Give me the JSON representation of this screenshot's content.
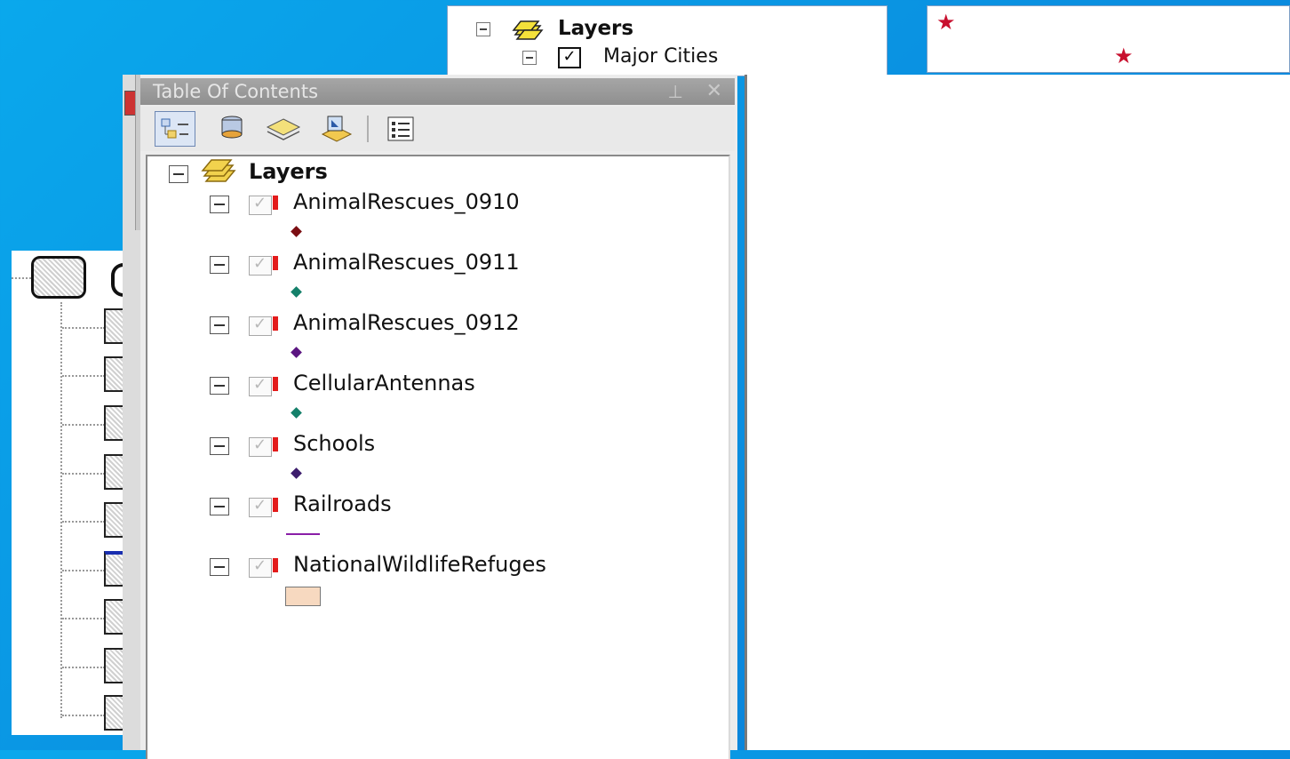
{
  "background_toc": {
    "root_label": "Layers",
    "layer_label": "Major Cities",
    "icons": [
      "minus-icon",
      "layers-icon",
      "checkbox-checked-icon"
    ]
  },
  "map_top": {
    "marker": "★",
    "marker_color": "#c8102e"
  },
  "toc": {
    "title": "Table Of Contents",
    "pin_glyph": "⊥",
    "close_glyph": "✕",
    "toolbar": [
      "list-by-drawing-order-icon",
      "list-by-source-icon",
      "list-by-visibility-icon",
      "list-by-selection-icon",
      "options-icon"
    ],
    "root": "Layers",
    "layers": [
      {
        "name": "AnimalRescues_0910",
        "symbol": "point",
        "color": "#7b0e12"
      },
      {
        "name": "AnimalRescues_0911",
        "symbol": "point",
        "color": "#14806a"
      },
      {
        "name": "AnimalRescues_0912",
        "symbol": "point",
        "color": "#5b1581"
      },
      {
        "name": "CellularAntennas",
        "symbol": "point",
        "color": "#14806a"
      },
      {
        "name": "Schools",
        "symbol": "point",
        "color": "#3d1d6d"
      },
      {
        "name": "Railroads",
        "symbol": "line",
        "color": "#8a1fa7"
      },
      {
        "name": "NationalWildlifeRefuges",
        "symbol": "polygon",
        "color": "#f7d9c0"
      }
    ]
  }
}
